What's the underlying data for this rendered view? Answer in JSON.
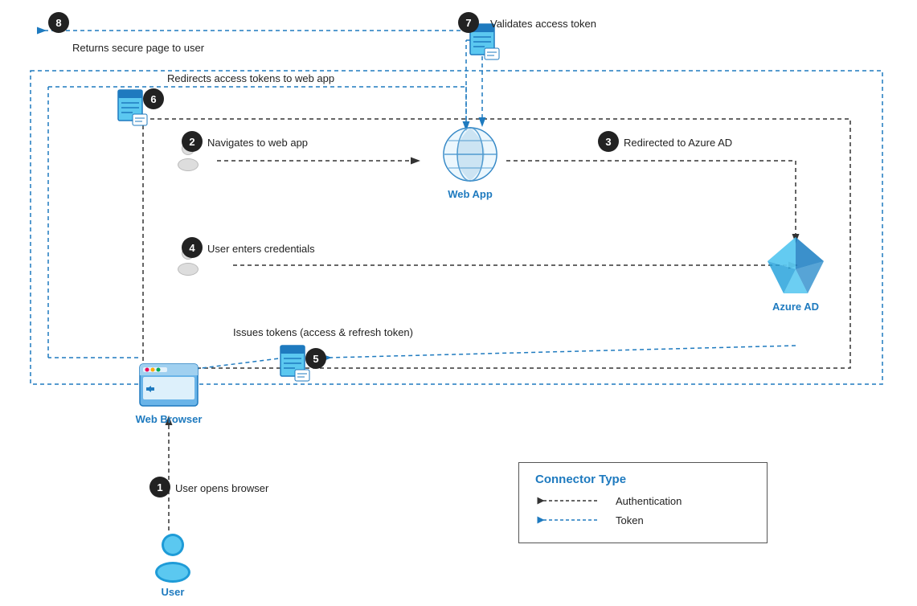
{
  "nodes": {
    "user": {
      "label": "User"
    },
    "webBrowser": {
      "label": "Web Browser"
    },
    "webApp": {
      "label": "Web App"
    },
    "azureAD": {
      "label": "Azure AD"
    }
  },
  "steps": {
    "s1": {
      "number": "1",
      "label": "User opens browser"
    },
    "s2": {
      "number": "2",
      "label": "Navigates to web app"
    },
    "s3": {
      "number": "3",
      "label": "Redirected to Azure AD"
    },
    "s4": {
      "number": "4",
      "label": "User enters credentials"
    },
    "s5": {
      "number": "5",
      "label": "Issues tokens (access & refresh token)"
    },
    "s6": {
      "number": "6",
      "label": "Redirects access tokens to web app"
    },
    "s7": {
      "number": "7",
      "label": "Validates access token"
    },
    "s8": {
      "number": "8",
      "label": "Returns secure page to user"
    }
  },
  "legend": {
    "title": "Connector Type",
    "items": [
      {
        "label": "Authentication"
      },
      {
        "label": "Token"
      }
    ]
  }
}
